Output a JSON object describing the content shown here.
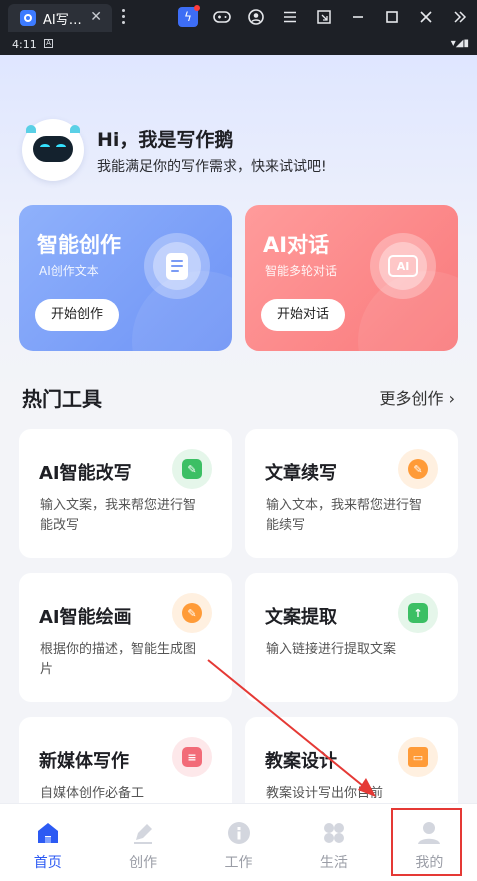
{
  "emulator": {
    "tab_title": "AI写…",
    "close_glyph": "✕"
  },
  "status": {
    "time": "4:11",
    "indicator": "A",
    "right_glyphs": "▾◢▮"
  },
  "header": {
    "greeting": "Hi，我是写作鹅",
    "subtitle": "我能满足你的写作需求，快来试试吧!"
  },
  "cards": [
    {
      "title": "智能创作",
      "subtitle": "AI创作文本",
      "button": "开始创作",
      "icon": "document-icon"
    },
    {
      "title": "AI对话",
      "subtitle": "智能多轮对话",
      "button": "开始对话",
      "icon": "chat-icon",
      "icon_text": "AI"
    }
  ],
  "section": {
    "title": "热门工具",
    "more": "更多创作 ›"
  },
  "tools": [
    {
      "title": "AI智能改写",
      "desc": "输入文案，我来帮您进行智能改写",
      "icon": "edit-icon",
      "color": "#3cbf64"
    },
    {
      "title": "文章续写",
      "desc": "输入文本，我来帮您进行智能续写",
      "icon": "pen-icon",
      "color": "#ff9b38"
    },
    {
      "title": "AI智能绘画",
      "desc": "根据你的描述，智能生成图片",
      "icon": "pen-icon",
      "color": "#ff9b38"
    },
    {
      "title": "文案提取",
      "desc": "输入链接进行提取文案",
      "icon": "upload-icon",
      "color": "#3cbf64"
    },
    {
      "title": "新媒体写作",
      "desc": "自媒体创作必备工",
      "icon": "note-icon",
      "color": "#f26b78"
    },
    {
      "title": "教案设计",
      "desc": "教案设计写出你目前",
      "icon": "board-icon",
      "color": "#ff9b38"
    }
  ],
  "nav": [
    {
      "label": "首页",
      "icon": "home-icon",
      "active": true
    },
    {
      "label": "创作",
      "icon": "create-icon",
      "active": false
    },
    {
      "label": "工作",
      "icon": "work-icon",
      "active": false
    },
    {
      "label": "生活",
      "icon": "life-icon",
      "active": false
    },
    {
      "label": "我的",
      "icon": "profile-icon",
      "active": false
    }
  ],
  "colors": {
    "accent": "#2c5af3",
    "annotation": "#e53935"
  }
}
